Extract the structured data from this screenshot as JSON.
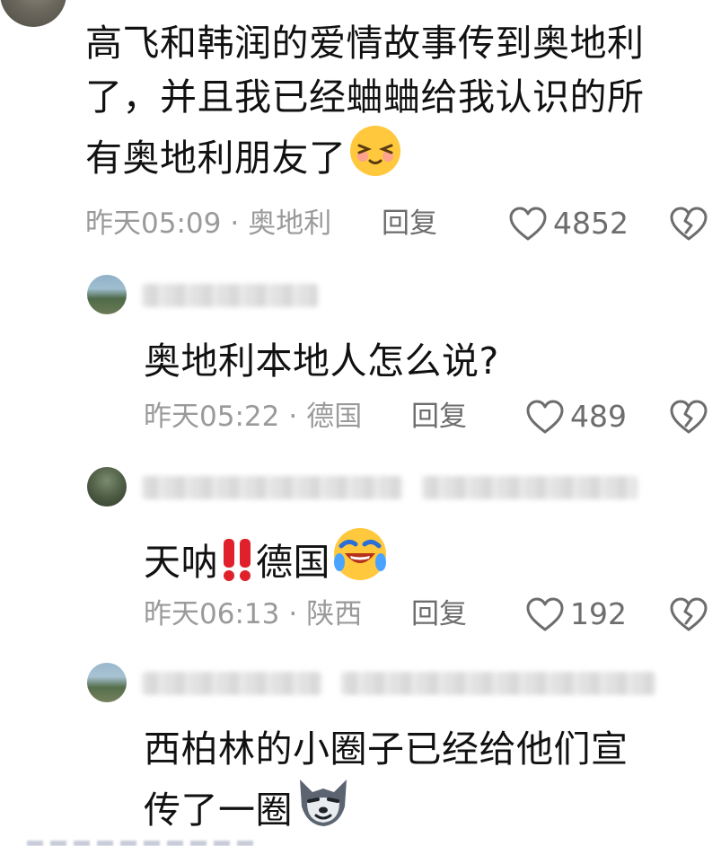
{
  "top_comment": {
    "lines": [
      "高飞和韩润的爱情故事传到奥地利",
      "了，并且我已经蛐蛐给我认识的所",
      "有奥地利朋友了"
    ],
    "time": "昨天05:09",
    "location": "奥地利",
    "reply_label": "回复",
    "likes": "4852",
    "emoji": "blushing-face-icon"
  },
  "replies": [
    {
      "text": "奥地利本地人怎么说?",
      "time": "昨天05:22",
      "location": "德国",
      "reply_label": "回复",
      "likes": "489"
    },
    {
      "text": "天呐",
      "text_after": "德国",
      "emojis": [
        "double-exclamation-icon",
        "crying-laughing-face-icon"
      ],
      "time": "昨天06:13",
      "location": "陕西",
      "reply_label": "回复",
      "likes": "192"
    },
    {
      "lines": [
        "西柏林的小圈子已经给他们宣",
        "传了一圈"
      ],
      "emoji": "wolf-face-icon"
    }
  ],
  "separator": "·",
  "colors": {
    "text": "#111111",
    "meta": "#9a9a9a",
    "action": "#6d6d6d",
    "emoji_yellow": "#ffc83d",
    "exclamation_red": "#e0202a"
  }
}
